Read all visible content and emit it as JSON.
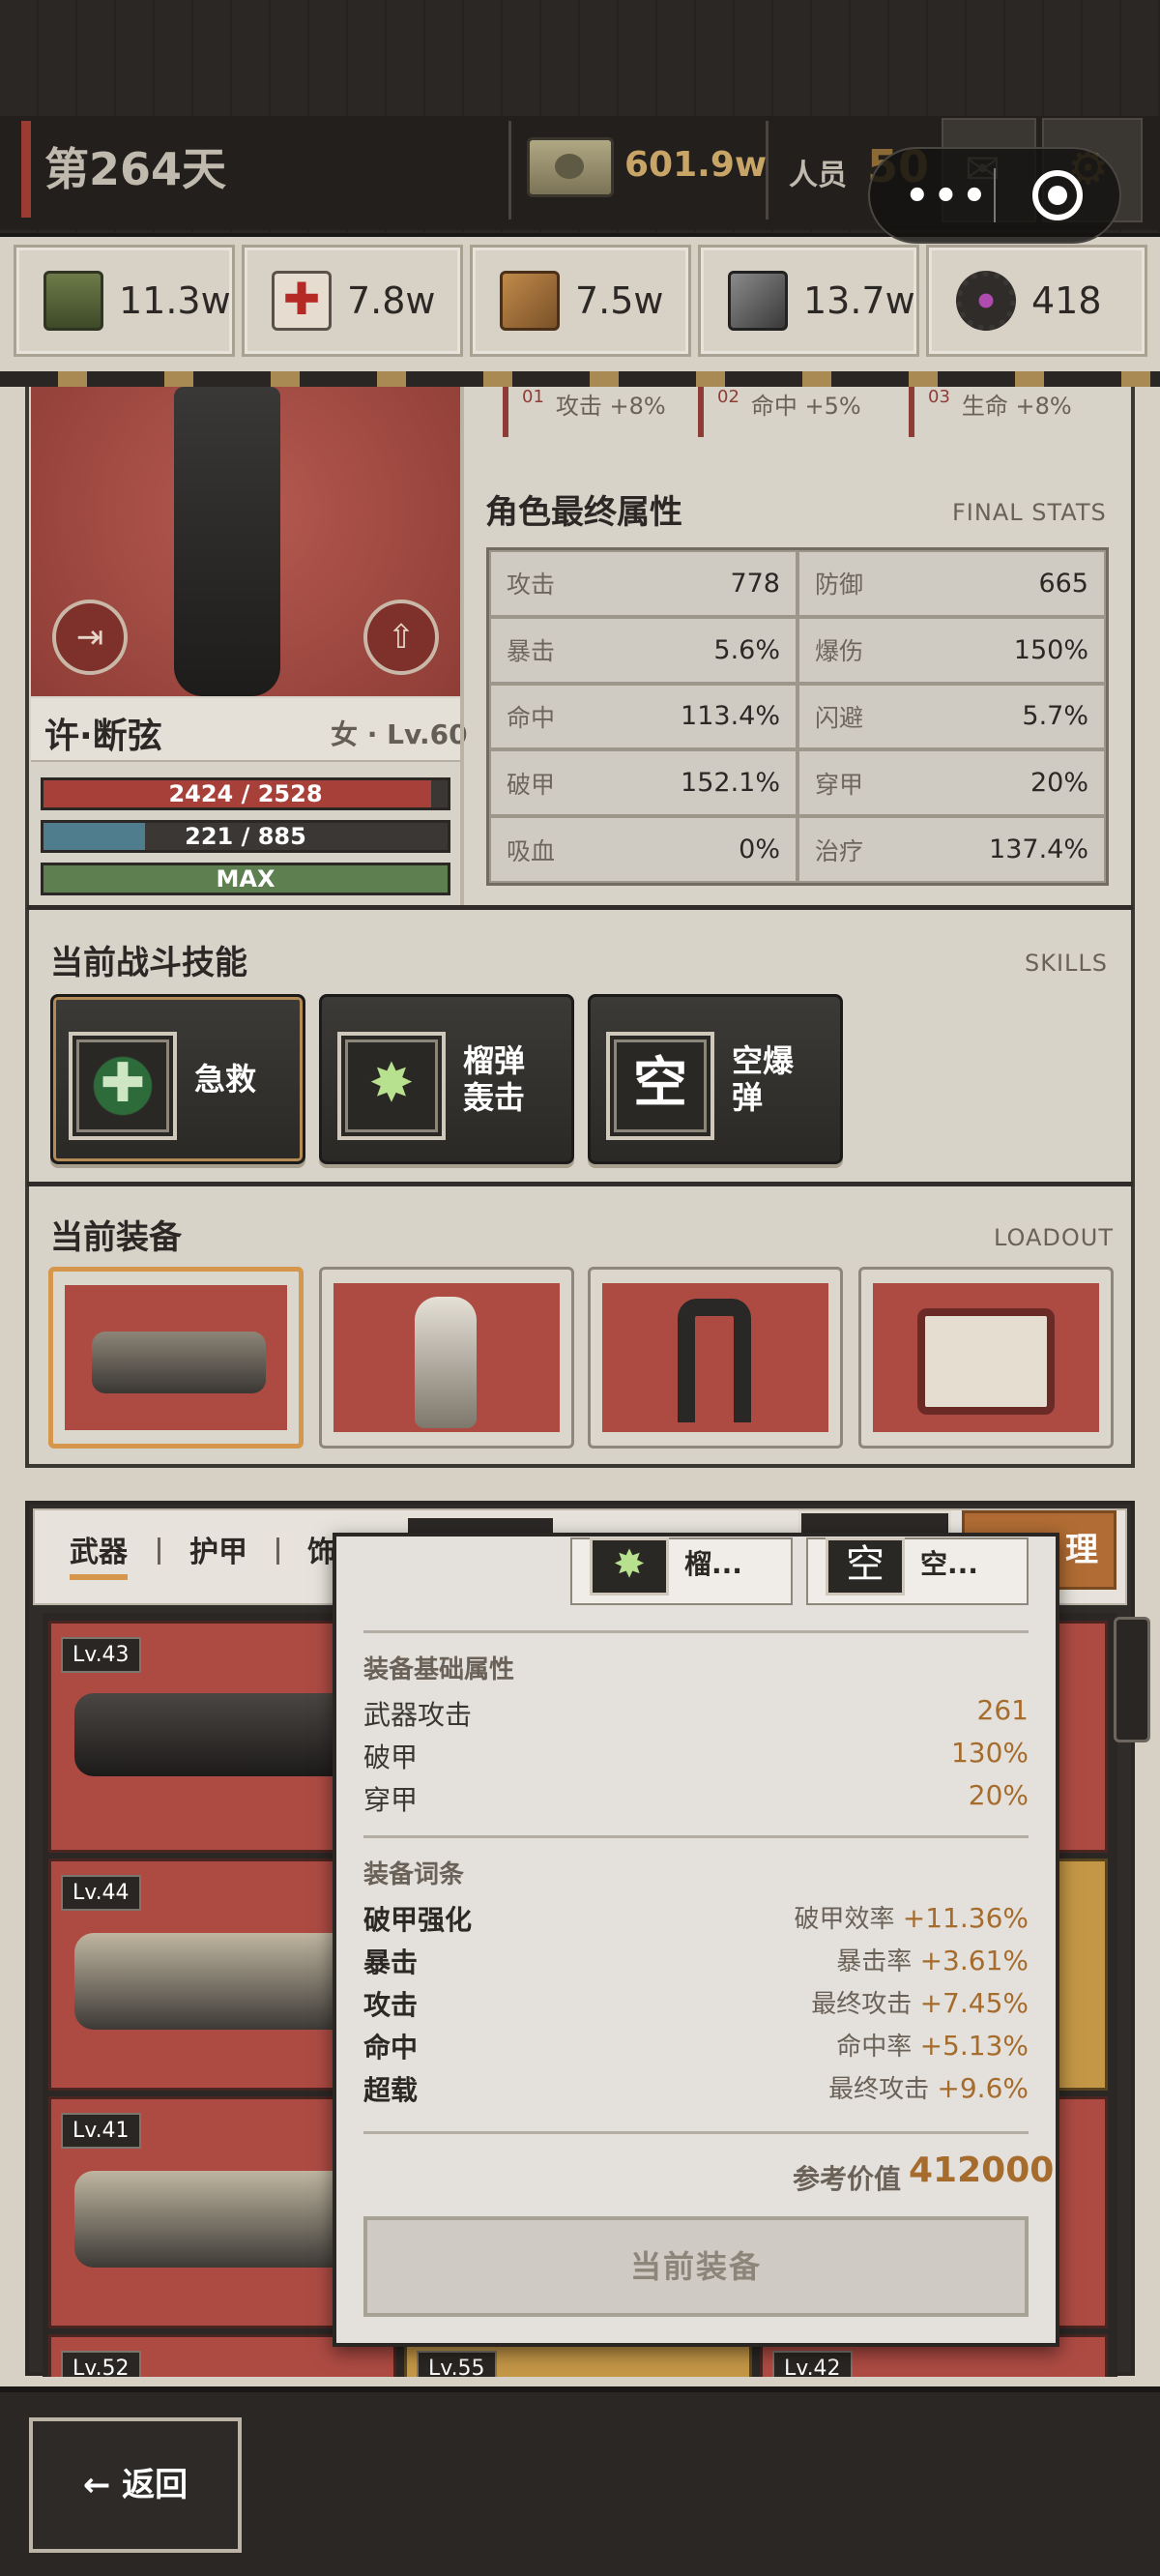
{
  "header": {
    "day": "第264天",
    "money": "601.9w",
    "staff_label": "人员",
    "staff_value": "50",
    "capsule_dots": "•••"
  },
  "resources": [
    {
      "icon": "grain-sack-icon",
      "value": "11.3w",
      "color": "#5a6a3a"
    },
    {
      "icon": "medkit-icon",
      "value": "7.8w",
      "color": "#d9d1c1"
    },
    {
      "icon": "wood-planks-icon",
      "value": "7.5w",
      "color": "#9a6a3a"
    },
    {
      "icon": "steel-ingots-icon",
      "value": "13.7w",
      "color": "#555"
    },
    {
      "icon": "gear-core-icon",
      "value": "418",
      "color": "#333"
    }
  ],
  "buffs": [
    {
      "no": "01",
      "text": "攻击 +8%"
    },
    {
      "no": "02",
      "text": "命中 +5%"
    },
    {
      "no": "03",
      "text": "生命 +8%"
    }
  ],
  "character": {
    "name": "许·断弦",
    "info": "女 · Lv.60",
    "hp": "2424 / 2528",
    "hp_fill": 0.959,
    "mp": "221 / 885",
    "mp_fill": 0.25,
    "xp": "MAX",
    "xp_fill": 1.0
  },
  "final_stats": {
    "title": "角色最终属性",
    "subtitle": "FINAL STATS",
    "rows": [
      {
        "k1": "攻击",
        "v1": "778",
        "k2": "防御",
        "v2": "665"
      },
      {
        "k1": "暴击",
        "v1": "5.6%",
        "k2": "爆伤",
        "v2": "150%"
      },
      {
        "k1": "命中",
        "v1": "113.4%",
        "k2": "闪避",
        "v2": "5.7%"
      },
      {
        "k1": "破甲",
        "v1": "152.1%",
        "k2": "穿甲",
        "v2": "20%"
      },
      {
        "k1": "吸血",
        "v1": "0%",
        "k2": "治疗",
        "v2": "137.4%"
      }
    ]
  },
  "skills": {
    "title": "当前战斗技能",
    "subtitle": "SKILLS",
    "items": [
      {
        "icon": "first-aid-icon",
        "glyph": "✚",
        "name": "急救"
      },
      {
        "icon": "grenade-launcher-icon",
        "glyph": "✸",
        "name": "榴弹\n轰击"
      },
      {
        "icon": "empty-slot-icon",
        "glyph": "空",
        "name": "空爆\n弹"
      }
    ]
  },
  "loadout": {
    "title": "当前装备",
    "subtitle": "LOADOUT",
    "items": [
      "grenade-launcher",
      "armor-suit",
      "leg-exoskeleton",
      "medical-device"
    ]
  },
  "inventory": {
    "tabs": [
      "武器",
      "护甲",
      "饰"
    ],
    "sort_label": "理",
    "items": [
      {
        "lv": "Lv.43",
        "style": "red"
      },
      {
        "lv": "Lv.44",
        "style": "red"
      },
      {
        "lv": "Lv.41",
        "style": "red"
      },
      {
        "lv": "Lv.52",
        "style": "red"
      },
      {
        "lv": "Lv.55",
        "style": "yellow"
      },
      {
        "lv": "Lv.42",
        "style": "red"
      }
    ]
  },
  "popup": {
    "skills_mini": [
      {
        "glyph": "✸",
        "text": "榴..."
      },
      {
        "glyph": "空",
        "text": "空..."
      }
    ],
    "base_title": "装备基础属性",
    "base": [
      {
        "k": "武器攻击",
        "v": "261"
      },
      {
        "k": "破甲",
        "v": "130%"
      },
      {
        "k": "穿甲",
        "v": "20%"
      }
    ],
    "affix_title": "装备词条",
    "affixes": [
      {
        "k": "破甲强化",
        "d": "破甲效率",
        "v": "+11.36%"
      },
      {
        "k": "暴击",
        "d": "暴击率",
        "v": "+3.61%"
      },
      {
        "k": "攻击",
        "d": "最终攻击",
        "v": "+7.45%"
      },
      {
        "k": "命中",
        "d": "命中率",
        "v": "+5.13%"
      },
      {
        "k": "超载",
        "d": "最终攻击",
        "v": "+9.6%"
      }
    ],
    "ref_label": "参考价值",
    "ref_value": "412000",
    "button": "当前装备"
  },
  "footer": {
    "back": "← 返回"
  }
}
